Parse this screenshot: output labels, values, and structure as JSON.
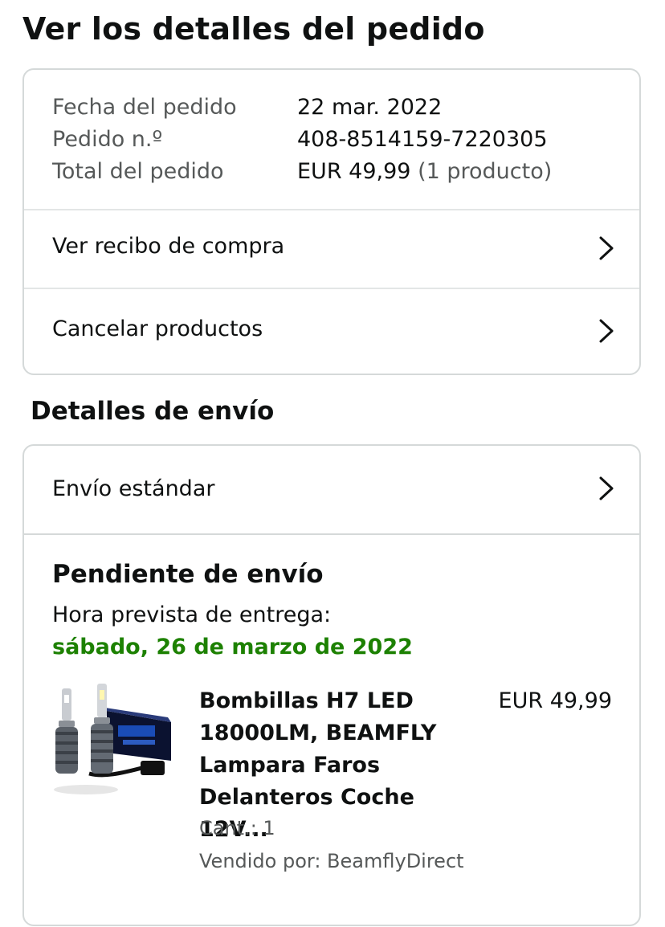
{
  "page": {
    "title": "Ver los detalles del pedido"
  },
  "order_summary": {
    "date_label": "Fecha del pedido",
    "date_value": "22 mar. 2022",
    "number_label": "Pedido n.º",
    "number_value": "408-8514159-7220305",
    "total_label": "Total del pedido",
    "total_value": "EUR 49,99",
    "total_items": "(1 producto)"
  },
  "actions": {
    "receipt_label": "Ver recibo de compra",
    "cancel_label": "Cancelar productos"
  },
  "shipping": {
    "section_title": "Detalles de envío",
    "method_label": "Envío estándar",
    "status": "Pendiente de envío",
    "eta_label": "Hora prevista de entrega:",
    "eta_date": "sábado, 26 de marzo de 2022"
  },
  "product": {
    "title": "Bombillas H7 LED 18000LM, BEAMFLY Lampara Faros Delanteros Coche 12V...",
    "price": "EUR 49,99",
    "quantity": "Cant.: 1",
    "seller": "Vendido por: BeamflyDirect",
    "image": "led-headlight-bulbs-product-image"
  },
  "icons": {
    "chevron": "chevron-right-icon"
  },
  "colors": {
    "delivery_green": "#1d8102",
    "muted_text": "#565959",
    "border": "#d5d9d9"
  }
}
